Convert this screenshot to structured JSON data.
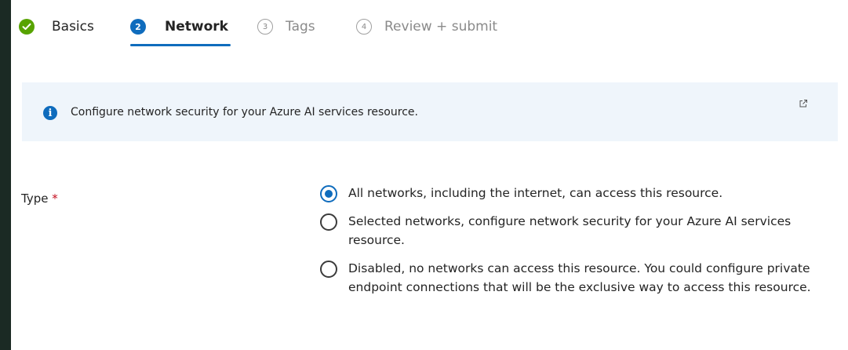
{
  "tabs": {
    "basics": "Basics",
    "network_num": "2",
    "network": "Network",
    "tags_num": "3",
    "tags": "Tags",
    "review_num": "4",
    "review": "Review + submit"
  },
  "info_banner": {
    "text": "Configure network security for your Azure AI services resource.",
    "icon": "info-icon"
  },
  "type_field": {
    "label": "Type",
    "required_marker": "*",
    "selected_index": 0,
    "options": [
      {
        "label": "All networks, including the internet, can access this resource."
      },
      {
        "label": "Selected networks, configure network security for your Azure AI services resource."
      },
      {
        "label": "Disabled, no networks can access this resource. You could configure private endpoint connections that will be the exclusive way to access this resource."
      }
    ]
  },
  "colors": {
    "accent": "#0f6cbd",
    "success": "#57a300",
    "banner_bg": "#eff5fb",
    "required": "#c50f1f"
  }
}
